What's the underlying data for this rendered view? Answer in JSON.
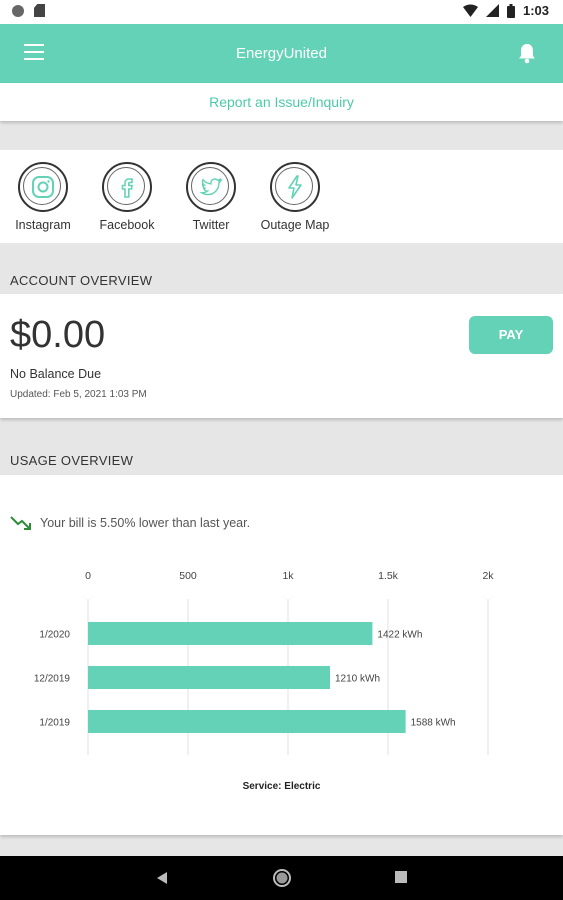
{
  "status_bar": {
    "time": "1:03"
  },
  "app_bar": {
    "title": "EnergyUnited",
    "menu_icon": "hamburger-menu-icon",
    "bell_icon": "bell-icon"
  },
  "report_link": "Report an Issue/Inquiry",
  "social": [
    {
      "label": "Instagram",
      "icon": "instagram-icon"
    },
    {
      "label": "Facebook",
      "icon": "facebook-icon"
    },
    {
      "label": "Twitter",
      "icon": "twitter-icon"
    },
    {
      "label": "Outage Map",
      "icon": "lightning-bolt-icon"
    }
  ],
  "account": {
    "heading": "ACCOUNT OVERVIEW",
    "amount": "$0.00",
    "balance_text": "No Balance Due",
    "updated": "Updated:  Feb 5, 2021 1:03 PM",
    "pay_label": "PAY"
  },
  "usage": {
    "heading": "USAGE OVERVIEW",
    "trend_text": "Your bill is 5.50% lower than last year.",
    "accent": "#63d2b6"
  },
  "chart_data": {
    "type": "bar",
    "orientation": "horizontal",
    "categories": [
      "1/2020",
      "12/2019",
      "1/2019"
    ],
    "values": [
      1422,
      1210,
      1588
    ],
    "data_labels": [
      "1422 kWh",
      "1210 kWh",
      "1588 kWh"
    ],
    "x_ticks": [
      0,
      500,
      1000,
      1500,
      2000
    ],
    "x_tick_labels": [
      "0",
      "500",
      "1k",
      "1.5k",
      "2k"
    ],
    "xlim": [
      0,
      2000
    ],
    "grid": true,
    "caption": "Service: Electric",
    "bar_color": "#63d2b6"
  }
}
